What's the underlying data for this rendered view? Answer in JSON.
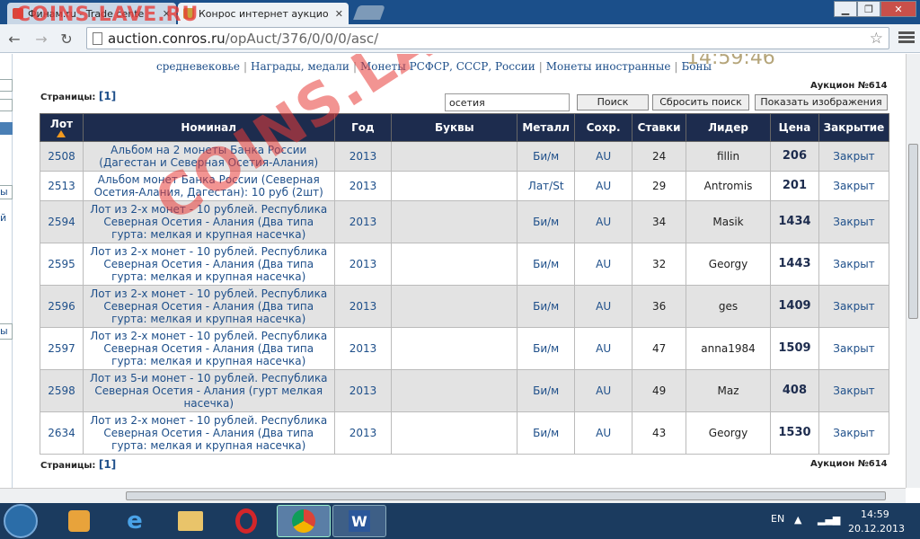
{
  "browser": {
    "tabs": [
      {
        "label": "Финам.ru - Trade cente"
      },
      {
        "label": "Конрос интернет аукцио"
      }
    ],
    "url_host": "auction.conros.ru",
    "url_path": "/opAuct/376/0/0/0/asc/"
  },
  "watermark_top": "COINS.LAVE.RU",
  "watermark": "COINS.LAVE.RU",
  "nav_links": [
    "средневековье",
    "Награды, медали",
    "Монеты РСФСР, СССР, России",
    "Монеты иностранные",
    "Боны"
  ],
  "clock": "14:59:46",
  "pages_label": "Страницы:",
  "pages_value": "[1]",
  "auction_label": "Аукцион №614",
  "search": {
    "value": "осетия",
    "search_button": "Поиск",
    "reset_button": "Сбросить поиск",
    "show_images_button": "Показать изображения"
  },
  "table": {
    "headers": [
      "Лот",
      "Номинал",
      "Год",
      "Буквы",
      "Металл",
      "Сохр.",
      "Ставки",
      "Лидер",
      "Цена",
      "Закрытие"
    ],
    "rows": [
      [
        "2508",
        "Альбом на 2 монеты Банка России (Дагестан и Северная Осетия-Алания)",
        "2013",
        "",
        "Би/м",
        "AU",
        "24",
        "fillin",
        "206",
        "Закрыт"
      ],
      [
        "2513",
        "Альбом монет Банка России (Северная Осетия-Алания, Дагестан): 10 руб (2шт)",
        "2013",
        "",
        "Лат/St",
        "AU",
        "29",
        "Antromis",
        "201",
        "Закрыт"
      ],
      [
        "2594",
        "Лот из 2-х монет - 10 рублей. Республика Северная Осетия - Алания (Два типа гурта: мелкая и крупная насечка)",
        "2013",
        "",
        "Би/м",
        "AU",
        "34",
        "Masik",
        "1434",
        "Закрыт"
      ],
      [
        "2595",
        "Лот из 2-х монет - 10 рублей. Республика Северная Осетия - Алания (Два типа гурта: мелкая и крупная насечка)",
        "2013",
        "",
        "Би/м",
        "AU",
        "32",
        "Georgy",
        "1443",
        "Закрыт"
      ],
      [
        "2596",
        "Лот из 2-х монет - 10 рублей. Республика Северная Осетия - Алания (Два типа гурта: мелкая и крупная насечка)",
        "2013",
        "",
        "Би/м",
        "AU",
        "36",
        "ges",
        "1409",
        "Закрыт"
      ],
      [
        "2597",
        "Лот из 2-х монет - 10 рублей. Республика Северная Осетия - Алания (Два типа гурта: мелкая и крупная насечка)",
        "2013",
        "",
        "Би/м",
        "AU",
        "47",
        "anna1984",
        "1509",
        "Закрыт"
      ],
      [
        "2598",
        "Лот из 5-и монет - 10 рублей. Республика Северная Осетия - Алания (гурт мелкая насечка)",
        "2013",
        "",
        "Би/м",
        "AU",
        "49",
        "Maz",
        "408",
        "Закрыт"
      ],
      [
        "2634",
        "Лот из 2-х монет - 10 рублей. Республика Северная Осетия - Алания (Два типа гурта: мелкая и крупная насечка)",
        "2013",
        "",
        "Би/м",
        "AU",
        "43",
        "Georgy",
        "1530",
        "Закрыт"
      ]
    ]
  },
  "left_panel_glyphs": [
    "ы",
    "й",
    "ы"
  ],
  "tray": {
    "lang": "EN",
    "time": "14:59",
    "date": "20.12.2013"
  },
  "colors": {
    "header_bg": "#1d2c4e",
    "link": "#1e4f8a",
    "watermark": "#e73c38",
    "row_alt": "#e3e3e3"
  }
}
